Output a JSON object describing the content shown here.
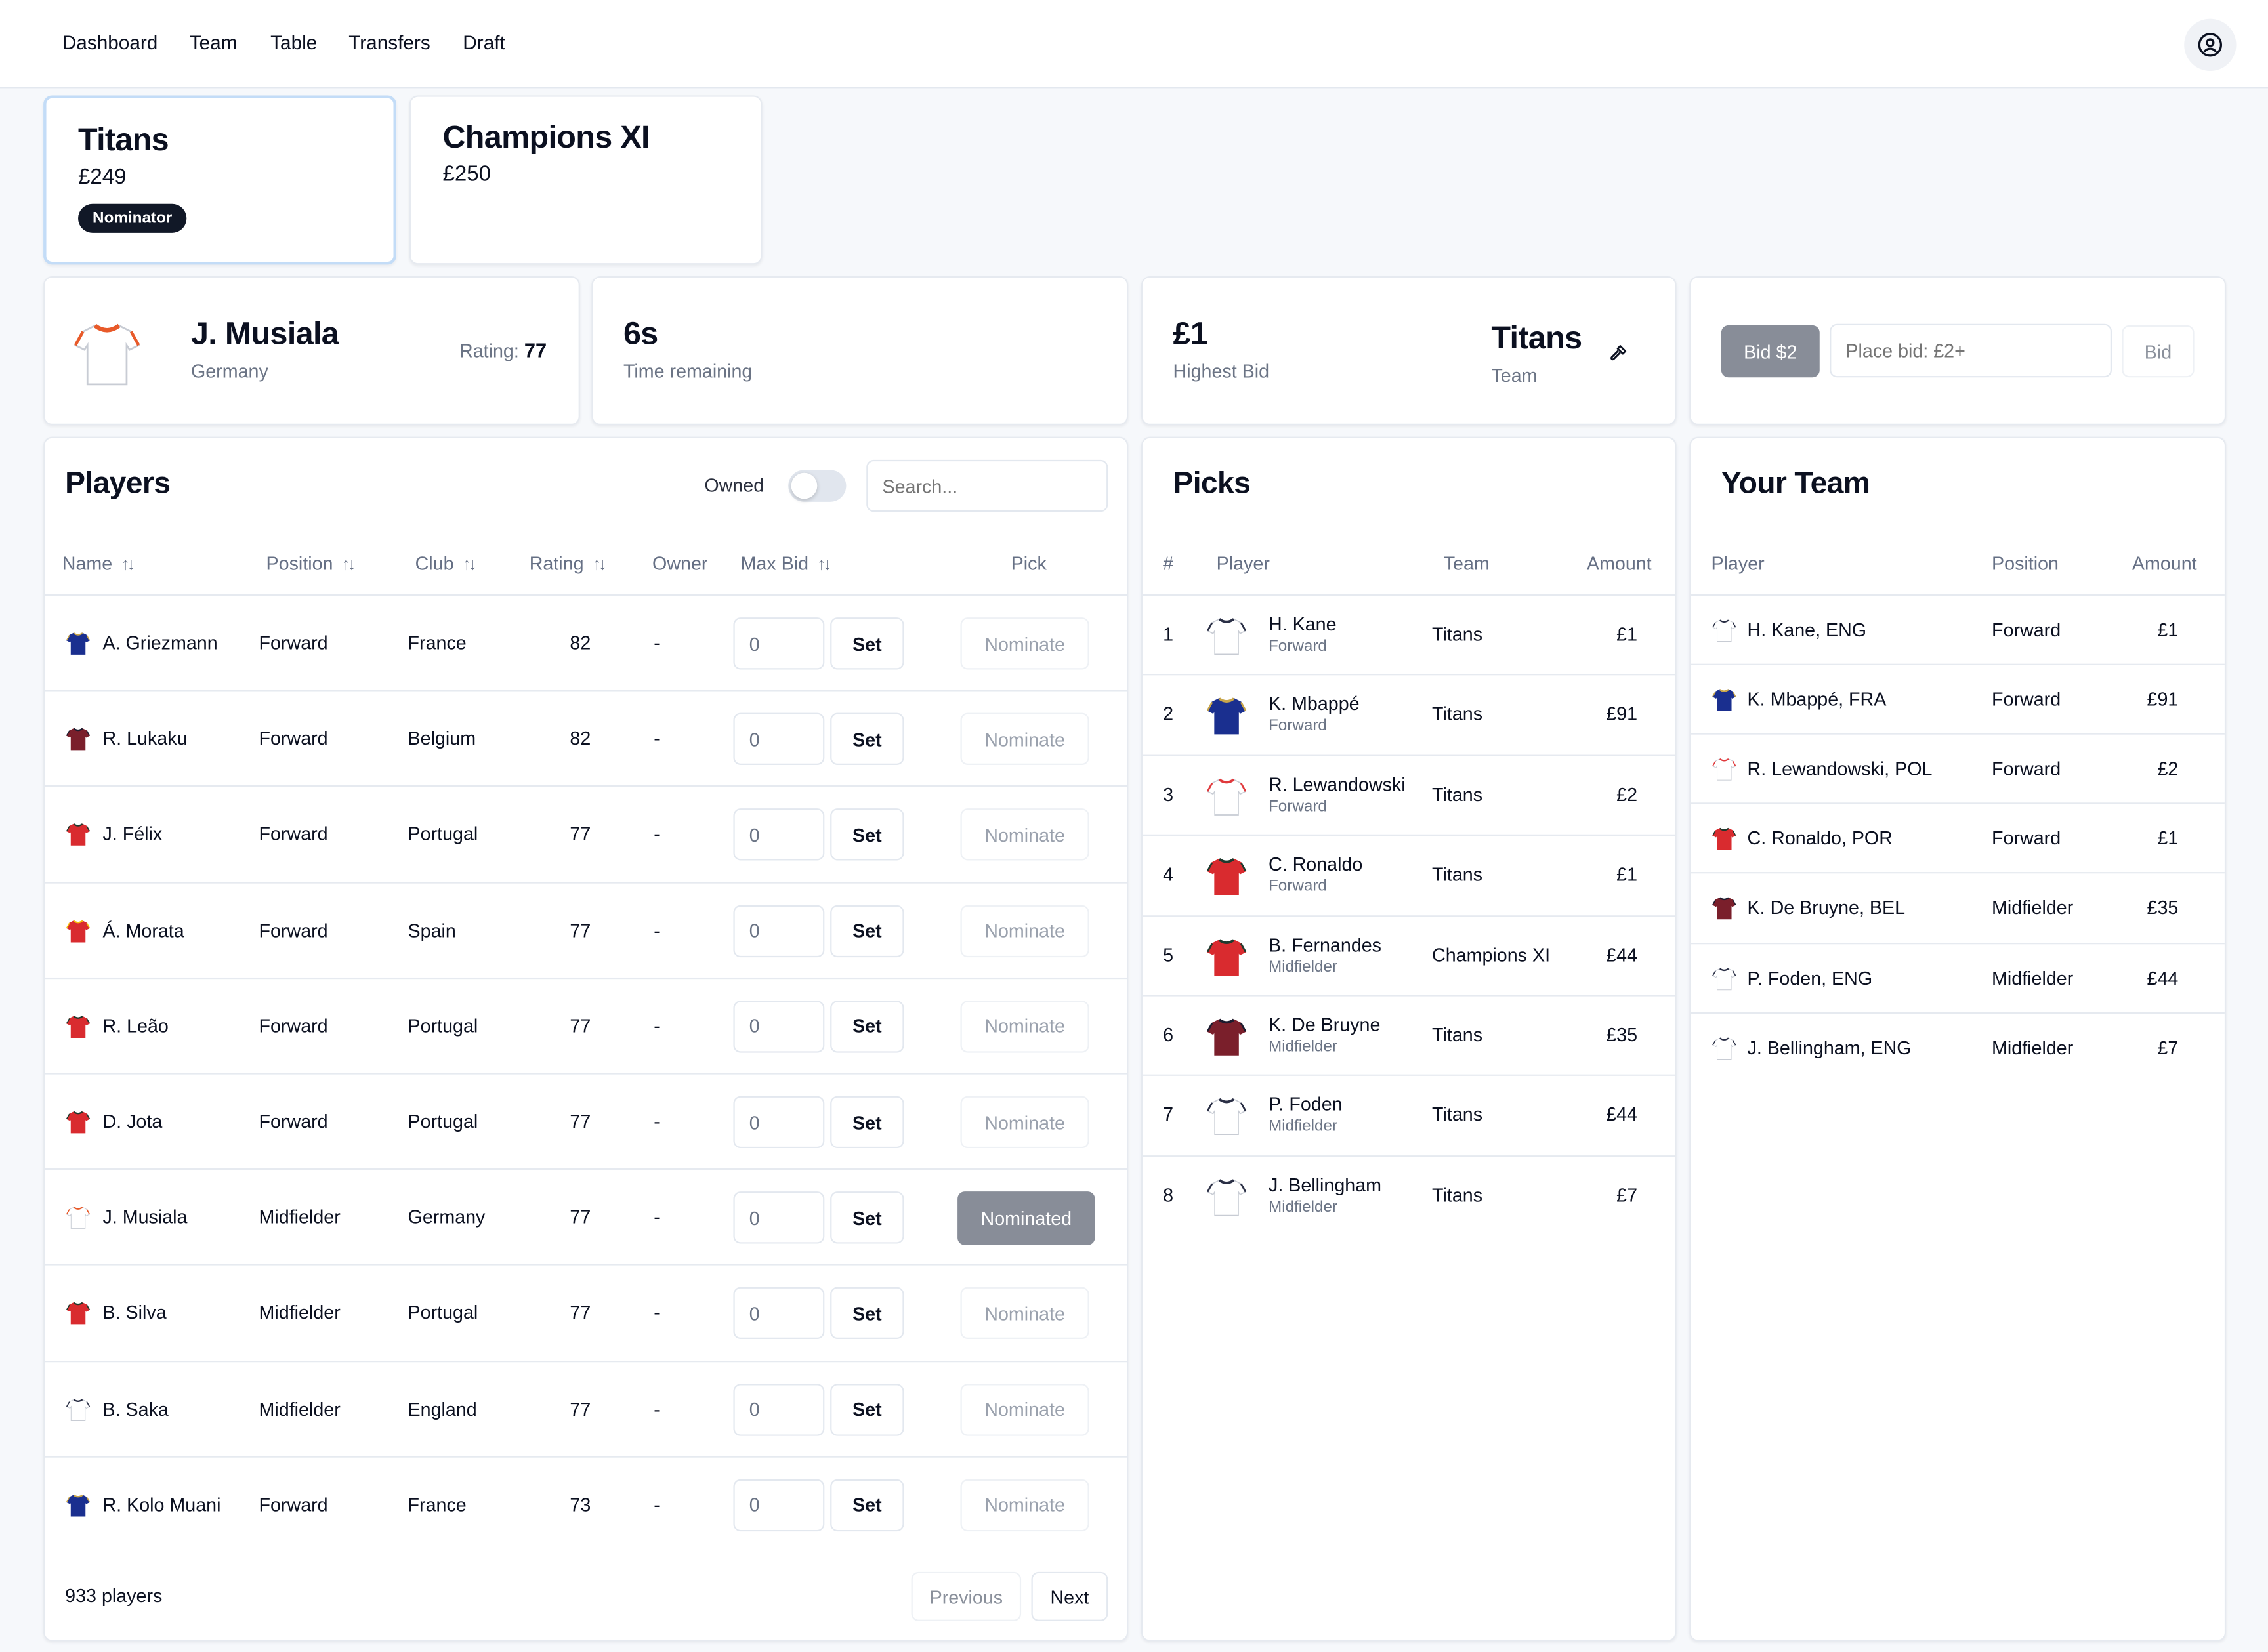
{
  "nav": {
    "items": [
      "Dashboard",
      "Team",
      "Table",
      "Transfers",
      "Draft"
    ],
    "avatar_icon": "user-circle-icon"
  },
  "teams": [
    {
      "name": "Titans",
      "budget": "£249",
      "badge": "Nominator",
      "selected": true
    },
    {
      "name": "Champions XI",
      "budget": "£250",
      "badge": null,
      "selected": false
    }
  ],
  "current_player": {
    "name": "J. Musiala",
    "country": "Germany",
    "rating_label": "Rating:",
    "rating": "77",
    "jersey": "germany"
  },
  "timer": {
    "value": "6s",
    "label": "Time remaining"
  },
  "highest_bid": {
    "value": "£1",
    "label": "Highest Bid",
    "team": "Titans",
    "team_label": "Team",
    "icon": "gavel-icon"
  },
  "bid_panel": {
    "quick_bid_label": "Bid $2",
    "input_placeholder": "Place bid: £2+",
    "input_value": "",
    "bid_button": "Bid"
  },
  "players": {
    "title": "Players",
    "owned_label": "Owned",
    "owned_on": false,
    "search_placeholder": "Search...",
    "columns": [
      "Name",
      "Position",
      "Club",
      "Rating",
      "Owner",
      "Max Bid",
      "Pick"
    ],
    "set_label": "Set",
    "rows": [
      {
        "name": "A. Griezmann",
        "position": "Forward",
        "club": "France",
        "rating": "82",
        "owner": "-",
        "max_bid": "0",
        "pick": "Nominate",
        "jersey": "france"
      },
      {
        "name": "R. Lukaku",
        "position": "Forward",
        "club": "Belgium",
        "rating": "82",
        "owner": "-",
        "max_bid": "0",
        "pick": "Nominate",
        "jersey": "belgium"
      },
      {
        "name": "J. Félix",
        "position": "Forward",
        "club": "Portugal",
        "rating": "77",
        "owner": "-",
        "max_bid": "0",
        "pick": "Nominate",
        "jersey": "portugal"
      },
      {
        "name": "Á. Morata",
        "position": "Forward",
        "club": "Spain",
        "rating": "77",
        "owner": "-",
        "max_bid": "0",
        "pick": "Nominate",
        "jersey": "spain"
      },
      {
        "name": "R. Leão",
        "position": "Forward",
        "club": "Portugal",
        "rating": "77",
        "owner": "-",
        "max_bid": "0",
        "pick": "Nominate",
        "jersey": "portugal"
      },
      {
        "name": "D. Jota",
        "position": "Forward",
        "club": "Portugal",
        "rating": "77",
        "owner": "-",
        "max_bid": "0",
        "pick": "Nominate",
        "jersey": "portugal"
      },
      {
        "name": "J. Musiala",
        "position": "Midfielder",
        "club": "Germany",
        "rating": "77",
        "owner": "-",
        "max_bid": "0",
        "pick": "Nominated",
        "jersey": "germany"
      },
      {
        "name": "B. Silva",
        "position": "Midfielder",
        "club": "Portugal",
        "rating": "77",
        "owner": "-",
        "max_bid": "0",
        "pick": "Nominate",
        "jersey": "portugal"
      },
      {
        "name": "B. Saka",
        "position": "Midfielder",
        "club": "England",
        "rating": "77",
        "owner": "-",
        "max_bid": "0",
        "pick": "Nominate",
        "jersey": "england"
      },
      {
        "name": "R. Kolo Muani",
        "position": "Forward",
        "club": "France",
        "rating": "73",
        "owner": "-",
        "max_bid": "0",
        "pick": "Nominate",
        "jersey": "france"
      }
    ],
    "count_label": "933 players",
    "prev_label": "Previous",
    "next_label": "Next"
  },
  "picks": {
    "title": "Picks",
    "columns": [
      "#",
      "Player",
      "Team",
      "Amount"
    ],
    "rows": [
      {
        "num": "1",
        "name": "H. Kane",
        "position": "Forward",
        "team": "Titans",
        "amount": "£1",
        "jersey": "england"
      },
      {
        "num": "2",
        "name": "K. Mbappé",
        "position": "Forward",
        "team": "Titans",
        "amount": "£91",
        "jersey": "france"
      },
      {
        "num": "3",
        "name": "R. Lewandowski",
        "position": "Forward",
        "team": "Titans",
        "amount": "£2",
        "jersey": "poland"
      },
      {
        "num": "4",
        "name": "C. Ronaldo",
        "position": "Forward",
        "team": "Titans",
        "amount": "£1",
        "jersey": "portugal"
      },
      {
        "num": "5",
        "name": "B. Fernandes",
        "position": "Midfielder",
        "team": "Champions XI",
        "amount": "£44",
        "jersey": "portugal"
      },
      {
        "num": "6",
        "name": "K. De Bruyne",
        "position": "Midfielder",
        "team": "Titans",
        "amount": "£35",
        "jersey": "belgium"
      },
      {
        "num": "7",
        "name": "P. Foden",
        "position": "Midfielder",
        "team": "Titans",
        "amount": "£44",
        "jersey": "england"
      },
      {
        "num": "8",
        "name": "J. Bellingham",
        "position": "Midfielder",
        "team": "Titans",
        "amount": "£7",
        "jersey": "england"
      }
    ]
  },
  "your_team": {
    "title": "Your Team",
    "columns": [
      "Player",
      "Position",
      "Amount"
    ],
    "rows": [
      {
        "player": "H. Kane, ENG",
        "position": "Forward",
        "amount": "£1",
        "jersey": "england"
      },
      {
        "player": "K. Mbappé, FRA",
        "position": "Forward",
        "amount": "£91",
        "jersey": "france"
      },
      {
        "player": "R. Lewandowski, POL",
        "position": "Forward",
        "amount": "£2",
        "jersey": "poland"
      },
      {
        "player": "C. Ronaldo, POR",
        "position": "Forward",
        "amount": "£1",
        "jersey": "portugal"
      },
      {
        "player": "K. De Bruyne, BEL",
        "position": "Midfielder",
        "amount": "£35",
        "jersey": "belgium"
      },
      {
        "player": "P. Foden, ENG",
        "position": "Midfielder",
        "amount": "£44",
        "jersey": "england"
      },
      {
        "player": "J. Bellingham, ENG",
        "position": "Midfielder",
        "amount": "£7",
        "jersey": "england"
      }
    ]
  },
  "jersey_colors": {
    "france": {
      "body": "#1a2f8f",
      "trim": "#c9a64a"
    },
    "belgium": {
      "body": "#7a1f2b",
      "trim": "#1b1b2e"
    },
    "portugal": {
      "body": "#d92b2f",
      "trim": "#1e3a2e"
    },
    "spain": {
      "body": "#d92b2f",
      "trim": "#f3c20b"
    },
    "germany": {
      "body": "#ffffff",
      "trim": "#e85a2a"
    },
    "england": {
      "body": "#ffffff",
      "trim": "#2a2f45"
    },
    "poland": {
      "body": "#ffffff",
      "trim": "#e0393c"
    }
  }
}
